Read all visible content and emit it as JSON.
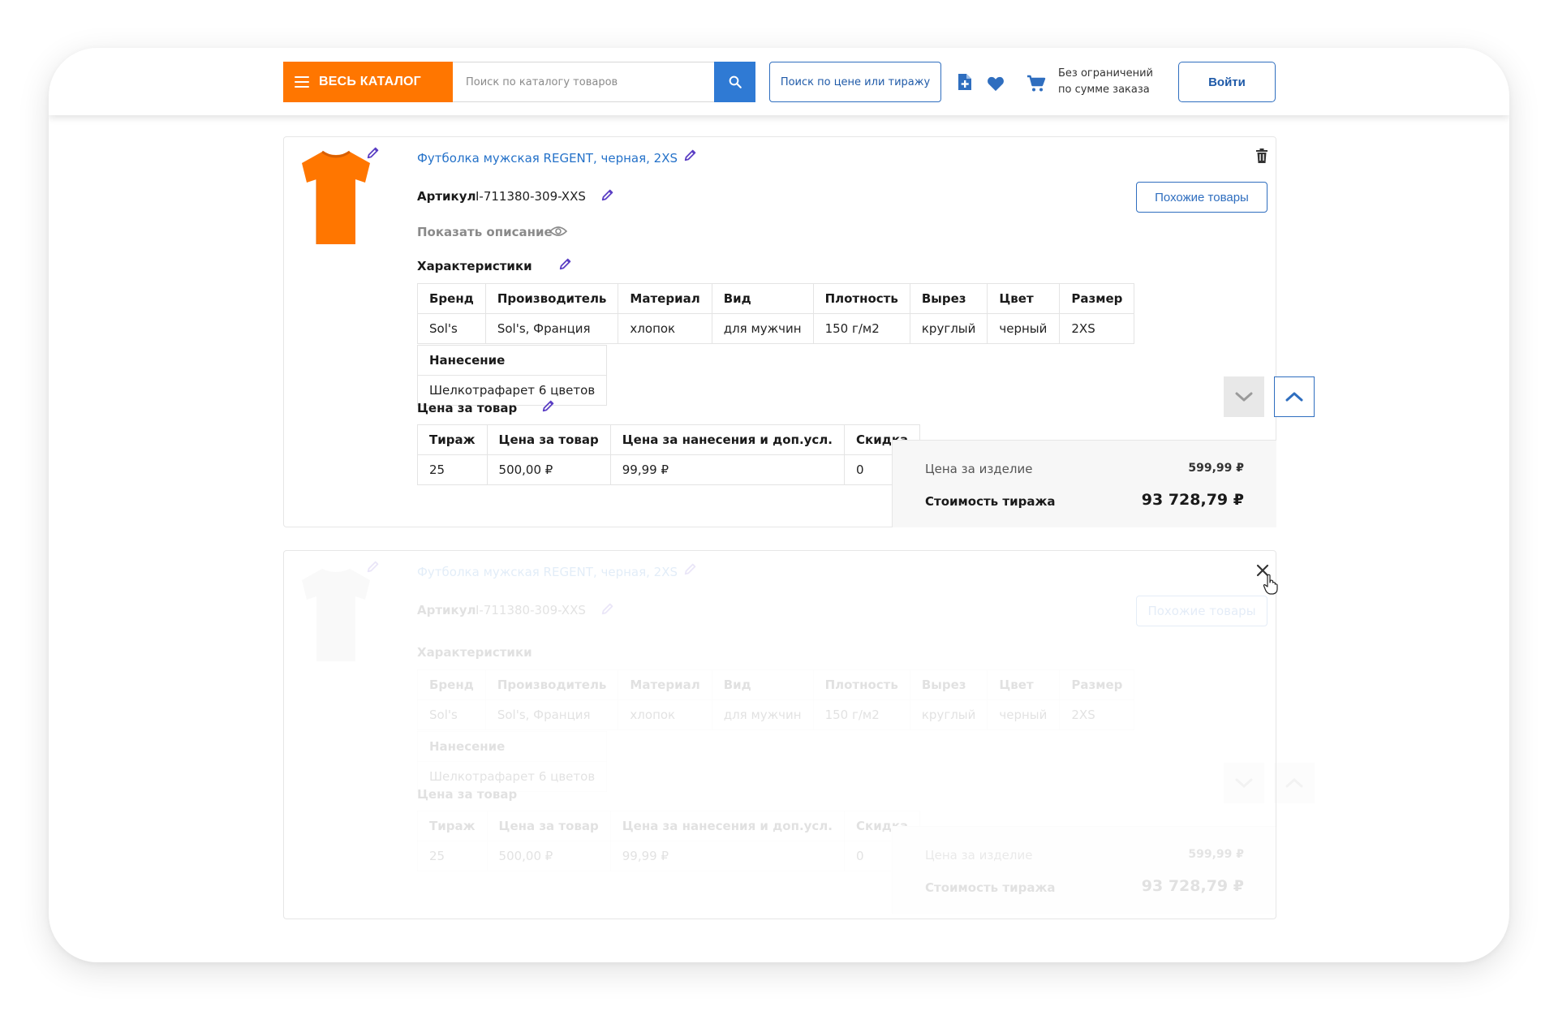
{
  "header": {
    "catalog_label": "ВЕСЬ КАТАЛОГ",
    "search_placeholder": "Поиск по каталогу товаров",
    "price_search_label": "Поиск по цене или тиражу",
    "promo_line1": "Без ограничений",
    "promo_line2": "по сумме заказа",
    "login_label": "Войти"
  },
  "product": {
    "title": "Футболка мужская REGENT, черная, 2XS",
    "sku_label": "Артикул",
    "sku_value": "I-711380-309-XXS",
    "show_description": "Показать описание",
    "similar_button": "Похожие товары",
    "characteristics_title": "Характеристики",
    "characteristics_headers": [
      "Бренд",
      "Производитель",
      "Материал",
      "Вид",
      "Плотность",
      "Вырез",
      "Цвет",
      "Размер"
    ],
    "characteristics_values": [
      "Sol's",
      "Sol's, Франция",
      "хлопок",
      "для мужчин",
      "150 г/м2",
      "круглый",
      "черный",
      "2XS"
    ],
    "application_header": "Нанесение",
    "application_value": "Шелкотрафарет 6 цветов",
    "price_title": "Цена за товар",
    "price_headers": [
      "Тираж",
      "Цена за товар",
      "Цена за нанесения и доп.усл.",
      "Скидка"
    ],
    "price_values": [
      "25",
      "500,00 ₽",
      "99,99 ₽",
      "0"
    ],
    "unit_price_label": "Цена за изделие",
    "unit_price_value": "599,99 ₽",
    "total_label": "Стоимость тиража",
    "total_value": "93 728,79 ₽"
  },
  "colors": {
    "accent_orange": "#ff7600",
    "accent_blue": "#2f7ad4",
    "link_blue": "#2572c9",
    "pencil_purple": "#5b3fc4"
  }
}
